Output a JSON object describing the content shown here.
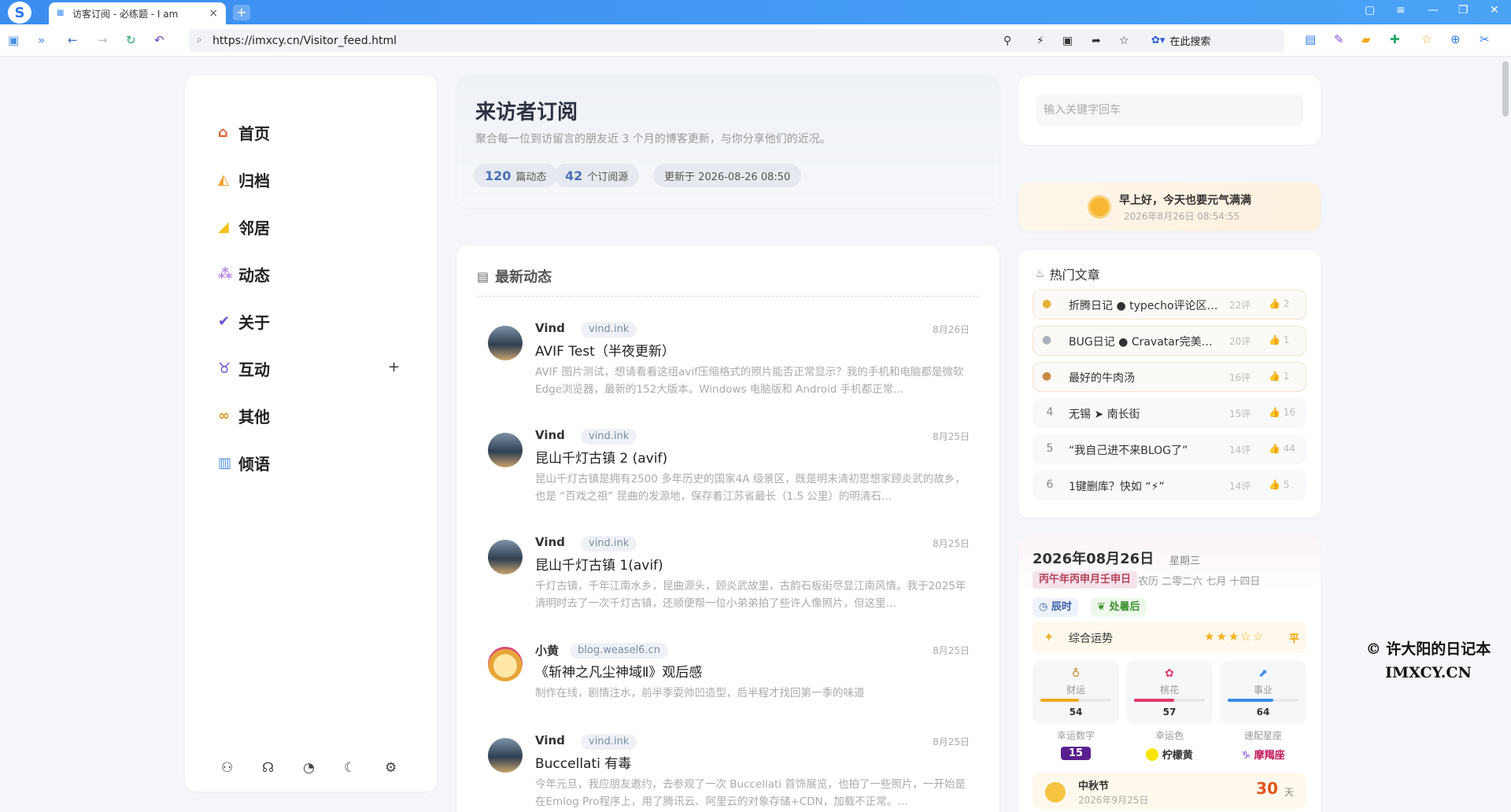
{
  "browser": {
    "tab_title": "访客订阅 - 必练题 - I am",
    "url": "https://imxcy.cn/Visitor_feed.html",
    "search_engine_label": "在此搜索",
    "new_tab": "+",
    "tab_close": "×"
  },
  "nav": {
    "items": [
      {
        "label": "首页",
        "icon": "home-icon"
      },
      {
        "label": "归档",
        "icon": "pizza-icon"
      },
      {
        "label": "邻居",
        "icon": "cheese-icon"
      },
      {
        "label": "动态",
        "icon": "bubbles-icon"
      },
      {
        "label": "关于",
        "icon": "check-icon"
      },
      {
        "label": "互动",
        "icon": "taurus-icon"
      },
      {
        "label": "其他",
        "icon": "pretzel-icon"
      },
      {
        "label": "倾语",
        "icon": "book-icon"
      }
    ],
    "expand_label": "+"
  },
  "header": {
    "title": "来访者订阅",
    "subtitle": "聚合每一位到访留言的朋友近 3 个月的博客更新，与你分享他们的近况。",
    "posts_count": "120",
    "posts_label": "篇动态",
    "sources_count": "42",
    "sources_label": "个订阅源",
    "updated": "更新于 2026-08-26 08:50"
  },
  "feed": {
    "title": "最新动态",
    "posts": [
      {
        "author": "Vind",
        "domain": "vind.ink",
        "date": "8月26日",
        "title": "AVIF Test（半夜更新）",
        "desc": "AVIF 图片测试，想请看看这组avif压缩格式的照片能否正常显示？我的手机和电脑都是微软Edge浏览器，最新的152大版本。Windows 电脑版和 Android 手机都正常…"
      },
      {
        "author": "Vind",
        "domain": "vind.ink",
        "date": "8月25日",
        "title": "昆山千灯古镇 2 (avif)",
        "desc": "昆山千灯古镇是拥有2500 多年历史的国家4A 级景区，既是明末清初思想家顾炎武的故乡，也是 “百戏之祖” 昆曲的发源地，保存着江苏省最长（1.5 公里）的明清石…"
      },
      {
        "author": "Vind",
        "domain": "vind.ink",
        "date": "8月25日",
        "title": "昆山千灯古镇 1(avif)",
        "desc": "千灯古镇，千年江南水乡，昆曲源头，顾炎武故里，古韵石板街尽显江南风情。我于2025年清明时去了一次千灯古镇，还顺便帮一位小弟弟拍了些许人像照片，但这里…"
      },
      {
        "author": "小黄",
        "domain": "blog.weasel6.cn",
        "date": "8月25日",
        "title": "《斩神之凡尘神域Ⅱ》观后感",
        "desc": "制作在线，剧情注水，前半季耍帅凹造型，后半程才找回第一季的味道"
      },
      {
        "author": "Vind",
        "domain": "vind.ink",
        "date": "8月25日",
        "title": "Buccellati 有毒",
        "desc": "今年元旦，我应朋友邀约，去参观了一次 Buccellati 首饰展览，也拍了一些照片，一开始是在Emlog Pro程序上，用了腾讯云、阿里云的对象存储+CDN，加载不正常。…"
      }
    ]
  },
  "search": {
    "placeholder": "输入关键字回车"
  },
  "greeting": {
    "text": "早上好，今天也要元气满满",
    "time": "2026年8月26日 08:54:55"
  },
  "hot": {
    "title": "热门文章",
    "items": [
      {
        "rank": "1",
        "medal": "gold-medal-icon",
        "title": "折腾日记 ● typecho评论区…",
        "comments": "22评",
        "likes": "2"
      },
      {
        "rank": "2",
        "medal": "silver-medal-icon",
        "title": "BUG日记 ● Cravatar完美…",
        "comments": "20评",
        "likes": "1"
      },
      {
        "rank": "3",
        "medal": "bronze-medal-icon",
        "title": "最好的牛肉汤",
        "comments": "16评",
        "likes": "1"
      },
      {
        "rank": "4",
        "medal": "",
        "title": "无锡 ➤ 南长街",
        "comments": "15评",
        "likes": "16"
      },
      {
        "rank": "5",
        "medal": "",
        "title": "“我自己进不来BLOG了”",
        "comments": "14评",
        "likes": "44"
      },
      {
        "rank": "6",
        "medal": "",
        "title": "1键删库？快如 “⚡”",
        "comments": "14评",
        "likes": "5"
      }
    ]
  },
  "calendar": {
    "date": "2026年08月26日",
    "weekday": "星期三",
    "ganzhi": "丙午年丙申月壬申日",
    "lunar": "农历 二零二六 七月 十四日",
    "tag_time": "辰时",
    "tag_term": "处暑后",
    "fortune_label": "综合运势",
    "fortune_stars": "★★★☆☆",
    "fortune_level": "平",
    "stats": [
      {
        "label": "财运",
        "value": "54",
        "fraction": 0.54,
        "color": "#f0a81e",
        "icon": "money-bag-icon"
      },
      {
        "label": "桃花",
        "value": "57",
        "fraction": 0.57,
        "color": "#e0386a",
        "icon": "flower-icon"
      },
      {
        "label": "事业",
        "value": "64",
        "fraction": 0.64,
        "color": "#3b8ee6",
        "icon": "chart-icon"
      }
    ],
    "lucky_number_label": "幸运数字",
    "lucky_number": "15",
    "lucky_color_label": "幸运色",
    "lucky_color": "柠檬黄",
    "star_sign_label": "速配星座",
    "star_sign": "摩羯座",
    "festival_name": "中秋节",
    "festival_date": "2026年9月25日",
    "festival_count": "30",
    "festival_unit": "天"
  },
  "watermark": {
    "line1": "© 许大阳的日记本",
    "line2": "IMXCY.CN"
  }
}
